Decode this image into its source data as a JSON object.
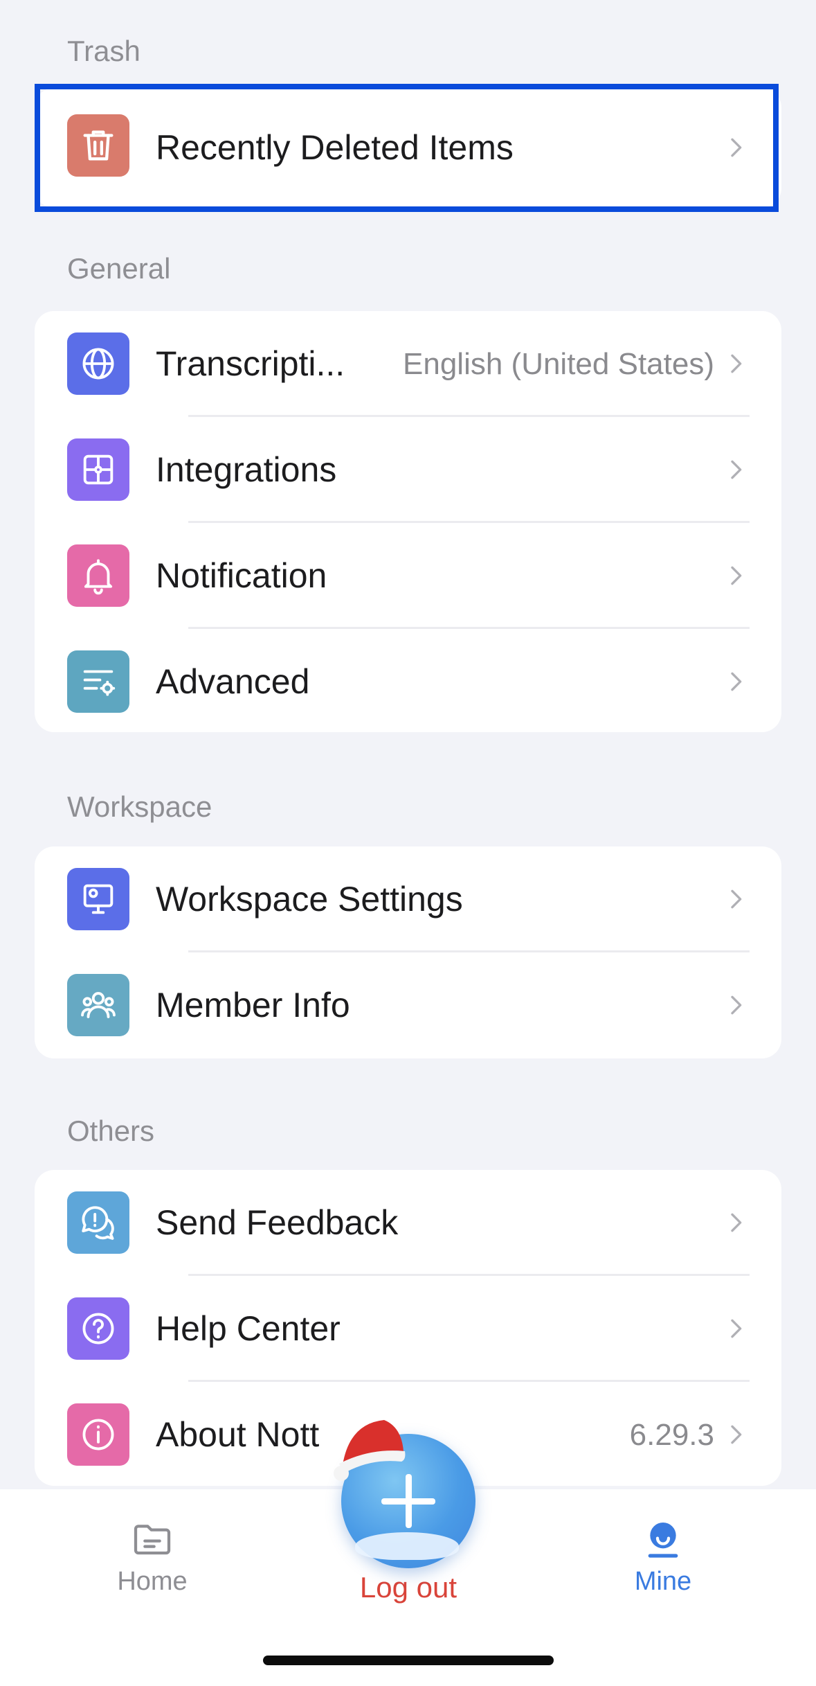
{
  "sections": {
    "trash": {
      "title": "Trash",
      "items": [
        {
          "label": "Recently Deleted Items",
          "icon": "trash-icon",
          "color": "#d97b6c"
        }
      ]
    },
    "general": {
      "title": "General",
      "items": [
        {
          "label": "Transcripti...",
          "value": "English (United States)",
          "icon": "globe-icon",
          "color": "#5b6ee8"
        },
        {
          "label": "Integrations",
          "icon": "puzzle-icon",
          "color": "#8a6cf0"
        },
        {
          "label": "Notification",
          "icon": "bell-icon",
          "color": "#e56aa8"
        },
        {
          "label": "Advanced",
          "icon": "settings-list-icon",
          "color": "#5ea6c0"
        }
      ]
    },
    "workspace": {
      "title": "Workspace",
      "items": [
        {
          "label": "Workspace Settings",
          "icon": "workspace-settings-icon",
          "color": "#5b6ee8"
        },
        {
          "label": "Member Info",
          "icon": "members-icon",
          "color": "#66a9c3"
        }
      ]
    },
    "others": {
      "title": "Others",
      "items": [
        {
          "label": "Send Feedback",
          "icon": "feedback-icon",
          "color": "#5ea6d9"
        },
        {
          "label": "Help Center",
          "icon": "help-icon",
          "color": "#8a6cf0"
        },
        {
          "label": "About Nott",
          "value": "6.29.3",
          "icon": "info-icon",
          "color": "#e56aa8"
        }
      ]
    }
  },
  "logout_label": "Log out",
  "tabbar": {
    "home_label": "Home",
    "mine_label": "Mine",
    "active": "Mine",
    "active_color": "#3a7be0",
    "inactive_color": "#8e8e93"
  },
  "highlight_color": "#0a4bdb"
}
